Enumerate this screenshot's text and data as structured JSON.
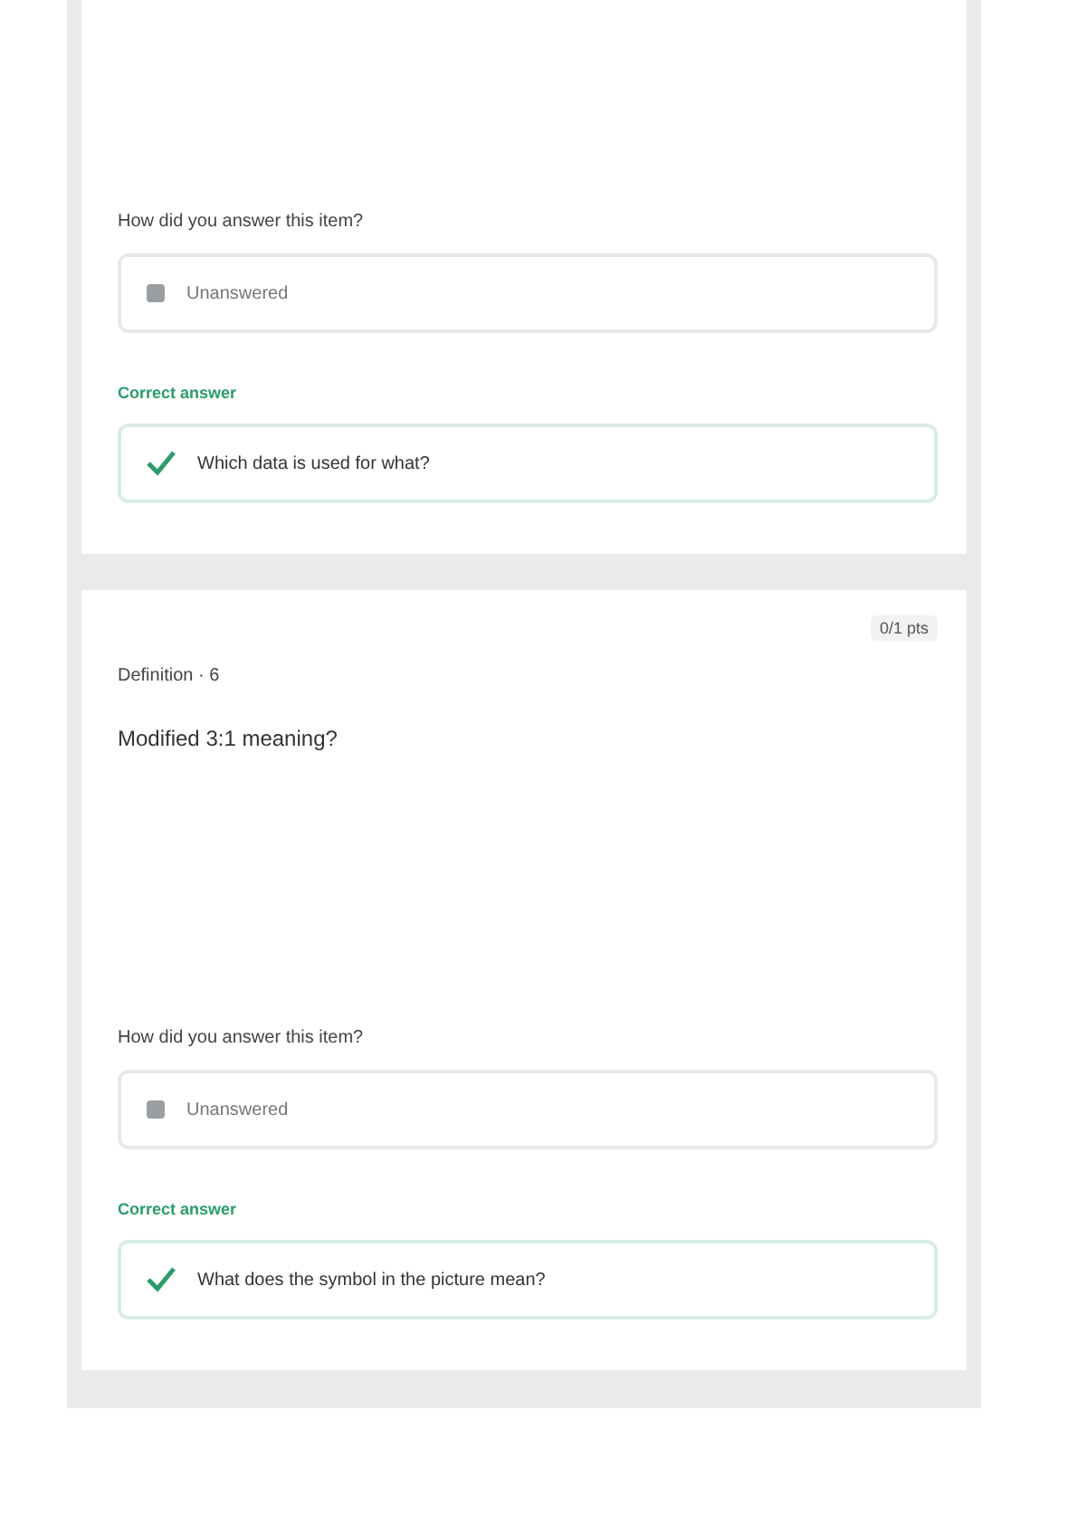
{
  "questions": [
    {
      "prompt": "How did you answer this item?",
      "answer": {
        "answered": false,
        "text": "Unanswered"
      },
      "correct_label": "Correct answer",
      "correct_answer": "Which data is used for what?"
    },
    {
      "points": "0/1 pts",
      "term": "Definition · 6",
      "question": "Modified 3:1 meaning?",
      "prompt": "How did you answer this item?",
      "answer": {
        "answered": false,
        "text": "Unanswered"
      },
      "correct_label": "Correct answer",
      "correct_answer": "What does the symbol in the picture mean?"
    }
  ]
}
